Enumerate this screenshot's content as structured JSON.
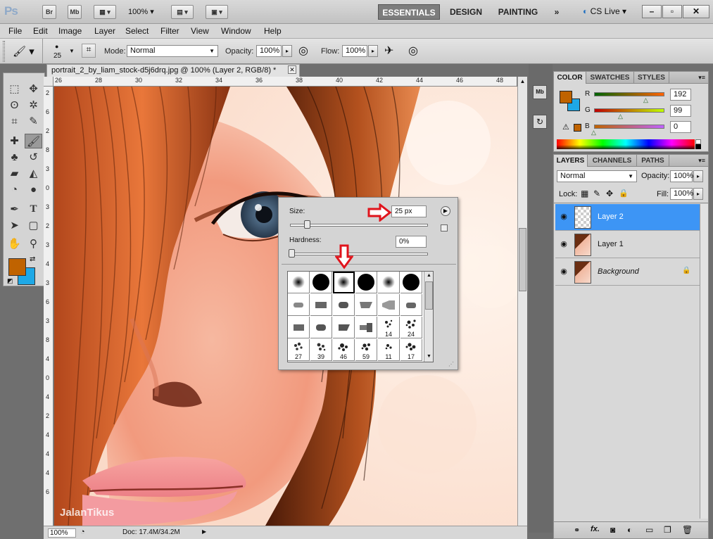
{
  "app": {
    "logo": "Ps",
    "bridge_label": "Br",
    "minibridge_label": "Mb",
    "zoom": "100%",
    "workspaces": [
      "ESSENTIALS",
      "DESIGN",
      "PAINTING"
    ],
    "more_label": "»",
    "cslive": "CS Live"
  },
  "menu": [
    "File",
    "Edit",
    "Image",
    "Layer",
    "Select",
    "Filter",
    "View",
    "Window",
    "Help"
  ],
  "options": {
    "brush_size": "25",
    "mode_label": "Mode:",
    "mode_value": "Normal",
    "opacity_label": "Opacity:",
    "opacity_value": "100%",
    "flow_label": "Flow:",
    "flow_value": "100%"
  },
  "document": {
    "tab_title": "portrait_2_by_liam_stock-d5j6drq.jpg @ 100% (Layer 2, RGB/8) *",
    "ruler_h": [
      "26",
      "28",
      "30",
      "32",
      "34",
      "36",
      "38",
      "40",
      "42",
      "44",
      "46",
      "48"
    ],
    "ruler_v": [
      "2",
      "6",
      "2",
      "8",
      "3",
      "0",
      "3",
      "2",
      "3",
      "4",
      "3",
      "6",
      "3",
      "8",
      "4",
      "0",
      "4",
      "2",
      "4",
      "4",
      "4",
      "6"
    ],
    "status_zoom": "100%",
    "status_doc": "Doc: 17.4M/34.2M",
    "watermark": "JalanTikus"
  },
  "brush_popup": {
    "size_label": "Size:",
    "size_value": "25 px",
    "hardness_label": "Hardness:",
    "hardness_value": "0%",
    "size_fraction": 0.1,
    "hardness_fraction": 0.0,
    "preset_numbers": [
      "14",
      "24",
      "27",
      "39",
      "46",
      "59",
      "11",
      "17"
    ]
  },
  "color_panel": {
    "tabs": [
      "COLOR",
      "SWATCHES",
      "STYLES"
    ],
    "r_label": "R",
    "r_value": "192",
    "g_label": "G",
    "g_value": "99",
    "b_label": "B",
    "b_value": "0",
    "fg_color": "#c06300",
    "bg_color": "#1ea8e6"
  },
  "layers_panel": {
    "tabs": [
      "LAYERS",
      "CHANNELS",
      "PATHS"
    ],
    "blend_mode": "Normal",
    "opacity_label": "Opacity:",
    "opacity_value": "100%",
    "lock_label": "Lock:",
    "fill_label": "Fill:",
    "fill_value": "100%",
    "layers": [
      "Layer 2",
      "Layer 1",
      "Background"
    ],
    "footer_fx": "fx."
  }
}
